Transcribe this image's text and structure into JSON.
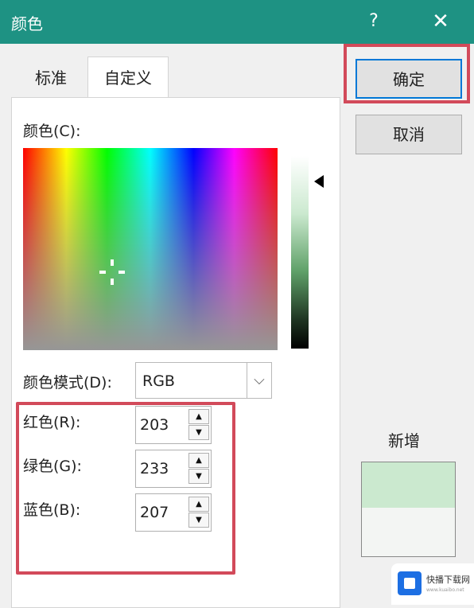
{
  "window": {
    "title": "颜色",
    "help_label": "?",
    "close_label": "✕",
    "accent_color": "#1e9283"
  },
  "tabs": [
    {
      "label": "标准",
      "active": false
    },
    {
      "label": "自定义",
      "active": true
    }
  ],
  "custom": {
    "colors_label": "颜色(C):",
    "color_model": {
      "label": "颜色模式(D):",
      "value": "RGB",
      "dropdown_icon": "chevron-down-icon"
    },
    "channels": [
      {
        "label": "红色(R):",
        "value": "203"
      },
      {
        "label": "绿色(G):",
        "value": "233"
      },
      {
        "label": "蓝色(B):",
        "value": "207"
      }
    ]
  },
  "buttons": {
    "ok": "确定",
    "cancel": "取消"
  },
  "preview": {
    "label": "新增",
    "new_color": "#cbe9cf",
    "current_color": "#f3f5f3"
  },
  "watermark": {
    "text": "快播下载网",
    "subtext": "www.kuaibo.net"
  },
  "highlight_color": "#d24a5a"
}
